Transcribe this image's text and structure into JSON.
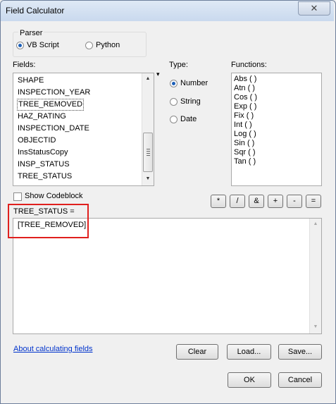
{
  "window": {
    "title": "Field Calculator",
    "close_glyph": "✕"
  },
  "parser": {
    "label": "Parser",
    "options": [
      {
        "label": "VB Script",
        "selected": true
      },
      {
        "label": "Python",
        "selected": false
      }
    ]
  },
  "fields": {
    "label": "Fields:",
    "items": [
      "SHAPE",
      "INSPECTION_YEAR",
      "TREE_REMOVED",
      "HAZ_RATING",
      "INSPECTION_DATE",
      "OBJECTID",
      "InsStatusCopy",
      "INSP_STATUS",
      "TREE_STATUS"
    ],
    "focused_item": "TREE_REMOVED"
  },
  "type": {
    "label": "Type:",
    "options": [
      {
        "label": "Number",
        "selected": true
      },
      {
        "label": "String",
        "selected": false
      },
      {
        "label": "Date",
        "selected": false
      }
    ]
  },
  "functions": {
    "label": "Functions:",
    "items": [
      "Abs ( )",
      "Atn ( )",
      "Cos ( )",
      "Exp ( )",
      "Fix ( )",
      "Int ( )",
      "Log ( )",
      "Sin ( )",
      "Sqr ( )",
      "Tan ( )"
    ]
  },
  "codeblock": {
    "label": "Show Codeblock",
    "checked": false
  },
  "operators": [
    "*",
    "/",
    "&",
    "+",
    "-",
    "="
  ],
  "expression": {
    "label": "TREE_STATUS =",
    "value": "[TREE_REMOVED]"
  },
  "help_link": "About calculating fields",
  "buttons": {
    "clear": "Clear",
    "load": "Load...",
    "save": "Save...",
    "ok": "OK",
    "cancel": "Cancel"
  },
  "icons": {
    "scroll_up": "▲",
    "scroll_down": "▼",
    "sort": "▾"
  },
  "colors": {
    "highlight_box": "#e0201e",
    "link": "#0033cc",
    "radio_selected": "#1c5fb8"
  }
}
